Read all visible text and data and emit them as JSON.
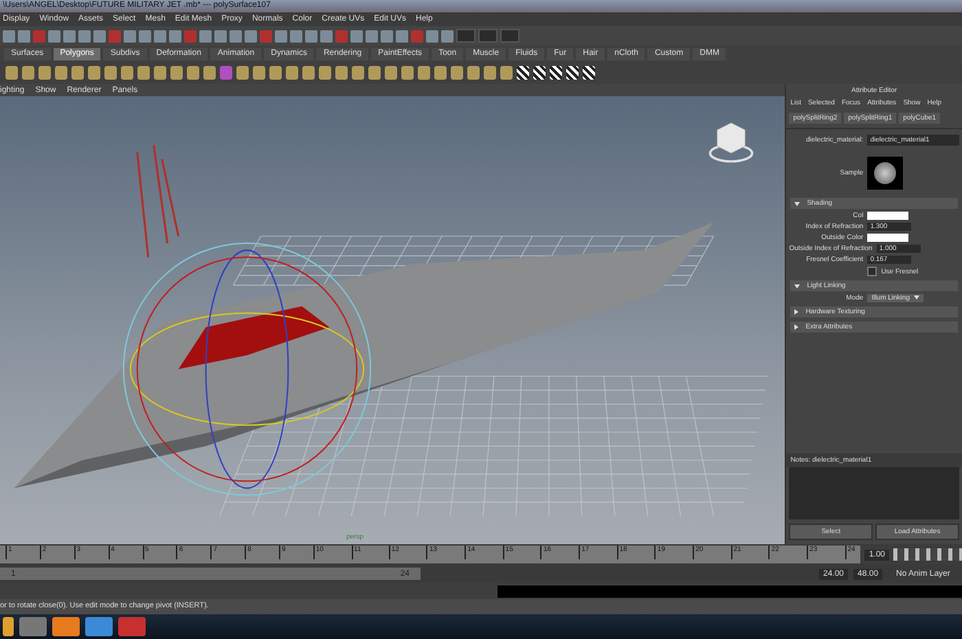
{
  "window": {
    "title": "\\Users\\ANGEL\\Desktop\\FUTURE MILITARY JET .mb*  ---  polySurface107"
  },
  "menu_bar": [
    "Display",
    "Window",
    "Assets",
    "Select",
    "Mesh",
    "Edit Mesh",
    "Proxy",
    "Normals",
    "Color",
    "Create UVs",
    "Edit UVs",
    "Help"
  ],
  "shelf_tabs": [
    {
      "label": "Surfaces",
      "selected": false
    },
    {
      "label": "Polygons",
      "selected": true
    },
    {
      "label": "Subdivs",
      "selected": false
    },
    {
      "label": "Deformation",
      "selected": false
    },
    {
      "label": "Animation",
      "selected": false
    },
    {
      "label": "Dynamics",
      "selected": false
    },
    {
      "label": "Rendering",
      "selected": false
    },
    {
      "label": "PaintEffects",
      "selected": false
    },
    {
      "label": "Toon",
      "selected": false
    },
    {
      "label": "Muscle",
      "selected": false
    },
    {
      "label": "Fluids",
      "selected": false
    },
    {
      "label": "Fur",
      "selected": false
    },
    {
      "label": "Hair",
      "selected": false
    },
    {
      "label": "nCloth",
      "selected": false
    },
    {
      "label": "Custom",
      "selected": false
    },
    {
      "label": "DMM",
      "selected": false
    }
  ],
  "viewport": {
    "menu": [
      "ighting",
      "Show",
      "Renderer",
      "Panels"
    ],
    "camera_label": "persp"
  },
  "attribute_editor": {
    "title": "Attribute Editor",
    "menu": [
      "List",
      "Selected",
      "Focus",
      "Attributes",
      "Show",
      "Help"
    ],
    "tabs": [
      {
        "label": "polySplitRing2",
        "selected": false
      },
      {
        "label": "polySplitRing1",
        "selected": false
      },
      {
        "label": "polyCube1",
        "selected": false
      }
    ],
    "material_label": "dielectric_material:",
    "material_name": "dielectric_material1",
    "sample_label": "Sample",
    "sections": [
      {
        "title": "Shading",
        "expanded": true,
        "attributes": [
          {
            "kind": "color",
            "label": "Col"
          },
          {
            "kind": "number",
            "label": "Index of Refraction",
            "value": "1.300"
          },
          {
            "kind": "color",
            "label": "Outside Color"
          },
          {
            "kind": "number",
            "label": "Outside Index of Refraction",
            "value": "1.000"
          },
          {
            "kind": "number",
            "label": "Fresnel Coefficient",
            "value": "0.167"
          },
          {
            "kind": "check",
            "label": "Use Fresnel",
            "checked": false
          }
        ]
      },
      {
        "title": "Light Linking",
        "expanded": true,
        "attributes": [
          {
            "kind": "dropdown",
            "label": "Mode",
            "value": "Illum Linking"
          }
        ]
      },
      {
        "title": "Hardware Texturing",
        "expanded": false
      },
      {
        "title": "Extra Attributes",
        "expanded": false
      }
    ],
    "notes_label": "Notes:  dielectric_material1",
    "buttons": [
      "Select",
      "Load Attributes"
    ]
  },
  "timeline": {
    "ticks": [
      "1",
      "2",
      "3",
      "4",
      "5",
      "6",
      "7",
      "8",
      "9",
      "10",
      "11",
      "12",
      "13",
      "14",
      "15",
      "16",
      "17",
      "18",
      "19",
      "20",
      "21",
      "22",
      "23",
      "24"
    ],
    "current_frame": "1.00",
    "range_start": "1",
    "range_end": "24",
    "end_time": "24.00",
    "max_time": "48.00",
    "anim_layer": "No Anim Layer"
  },
  "help_line": "or to rotate close(0). Use edit mode to change pivot (INSERT)."
}
